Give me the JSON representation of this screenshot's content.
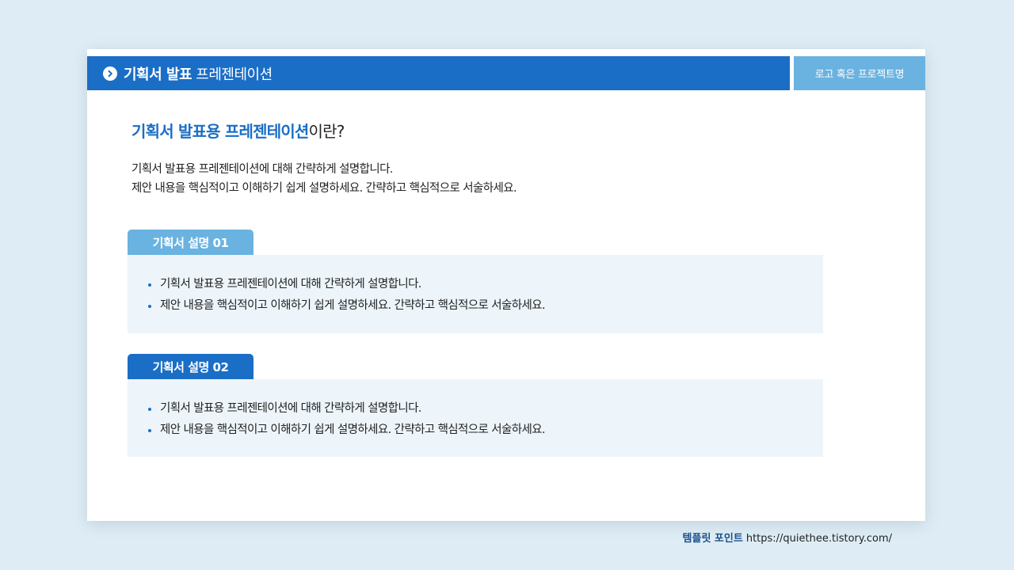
{
  "header": {
    "title_bold": "기획서 발표",
    "title_rest": " 프레젠테이션",
    "logo_text": "로고 혹은 프로젝트명",
    "icon": "chevron-right-circle-icon"
  },
  "main": {
    "heading_highlight": "기획서 발표용 프레젠테이션",
    "heading_suffix": "이란?",
    "intro_lines": [
      "기획서 발표용 프레젠테이션에 대해 간략하게 설명합니다.",
      "제안 내용을 핵심적이고 이해하기 쉽게 설명하세요. 간략하고 핵심적으로 서술하세요."
    ]
  },
  "sections": [
    {
      "tab_label": "기획서 설명 01",
      "bullets": [
        "기획서 발표용 프레젠테이션에 대해 간략하게 설명합니다.",
        "제안 내용을 핵심적이고 이해하기 쉽게 설명하세요. 간략하고 핵심적으로 서술하세요."
      ]
    },
    {
      "tab_label": "기획서 설명 02",
      "bullets": [
        "기획서 발표용 프레젠테이션에 대해 간략하게 설명합니다.",
        "제안 내용을 핵심적이고 이해하기 쉽게 설명하세요. 간략하고 핵심적으로 서술하세요."
      ]
    }
  ],
  "footer": {
    "brand": "템플릿 포인트",
    "url": "https://quiethee.tistory.com/"
  },
  "colors": {
    "primary_blue": "#1b6ec6",
    "light_blue": "#6ab2e0",
    "box_bg": "#edf5fb",
    "page_bg": "#deedf5"
  }
}
